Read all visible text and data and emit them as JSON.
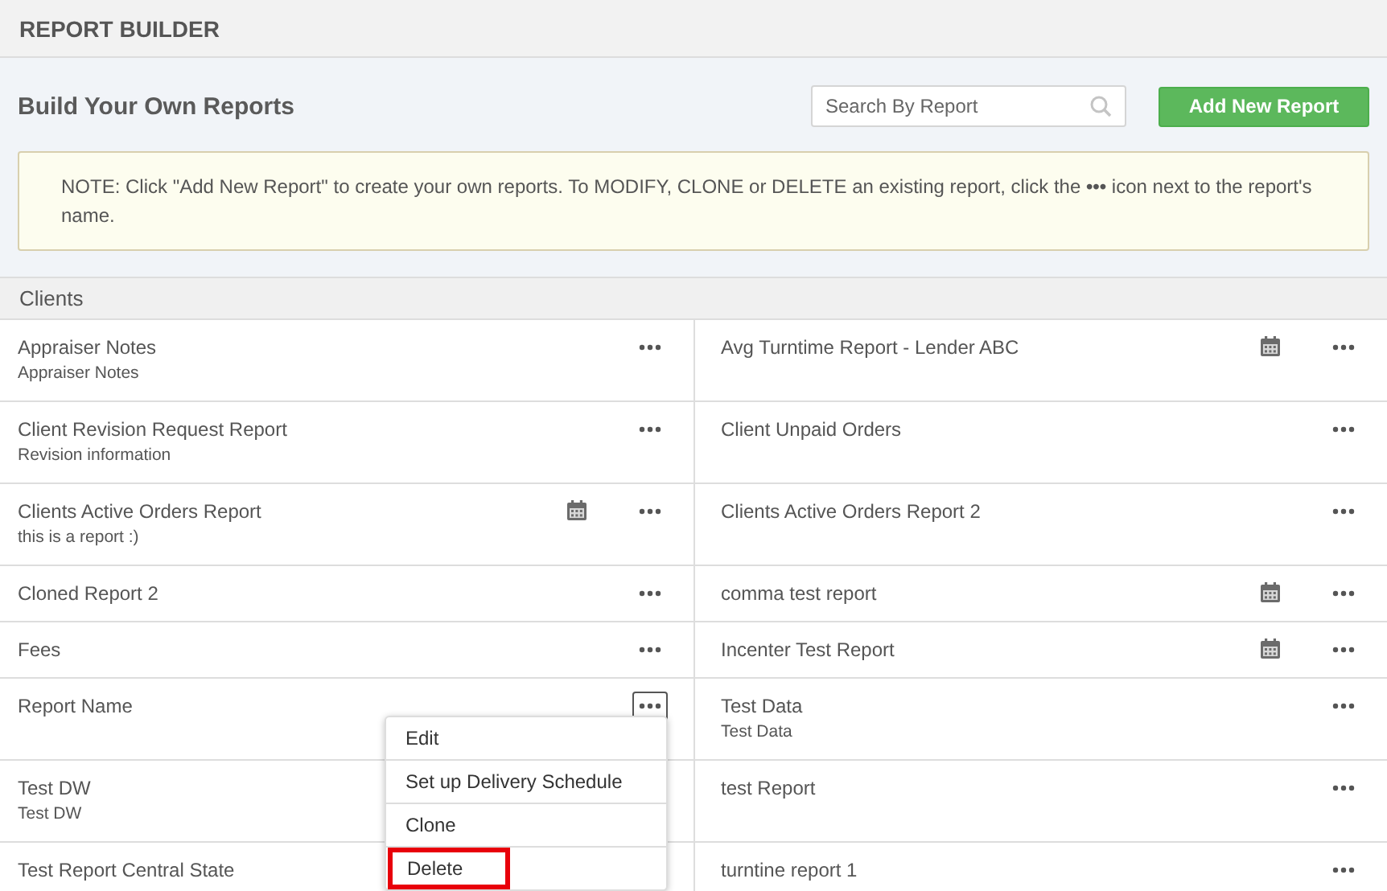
{
  "page_title": "REPORT BUILDER",
  "heading": "Build Your Own Reports",
  "search": {
    "placeholder": "Search By Report"
  },
  "add_button": "Add New Report",
  "note": "NOTE: Click \"Add New Report\" to create your own reports. To MODIFY, CLONE or DELETE an existing report, click the **•••** icon next to the report's name.",
  "section": {
    "title": "Clients",
    "reports": [
      {
        "name": "Appraiser Notes",
        "description": "Appraiser Notes",
        "scheduled": false
      },
      {
        "name": "Avg Turntime Report - Lender ABC",
        "scheduled": true
      },
      {
        "name": "Client Revision Request Report",
        "description": "Revision information",
        "scheduled": false
      },
      {
        "name": "Client Unpaid Orders",
        "scheduled": false
      },
      {
        "name": "Clients Active Orders Report",
        "description": "this is a report :)",
        "scheduled": true
      },
      {
        "name": "Clients Active Orders Report 2",
        "scheduled": false
      },
      {
        "name": "Cloned Report 2",
        "scheduled": false
      },
      {
        "name": "comma test report",
        "scheduled": true
      },
      {
        "name": "Fees",
        "scheduled": false
      },
      {
        "name": "Incenter Test Report",
        "scheduled": true
      },
      {
        "name": "Report Name",
        "scheduled": false,
        "menu_open": true
      },
      {
        "name": "Test Data",
        "description": "Test Data",
        "scheduled": false
      },
      {
        "name": "Test DW",
        "description": "Test DW",
        "scheduled": false
      },
      {
        "name": "test Report",
        "scheduled": false
      },
      {
        "name": "Test Report Central State",
        "scheduled": false
      },
      {
        "name": "turntine report 1",
        "scheduled": false
      }
    ]
  },
  "context_menu": {
    "items": [
      {
        "label": "Edit",
        "highlighted": false
      },
      {
        "label": "Set up Delivery Schedule",
        "highlighted": false
      },
      {
        "label": "Clone",
        "highlighted": false
      },
      {
        "label": "Delete",
        "highlighted": true
      }
    ]
  }
}
